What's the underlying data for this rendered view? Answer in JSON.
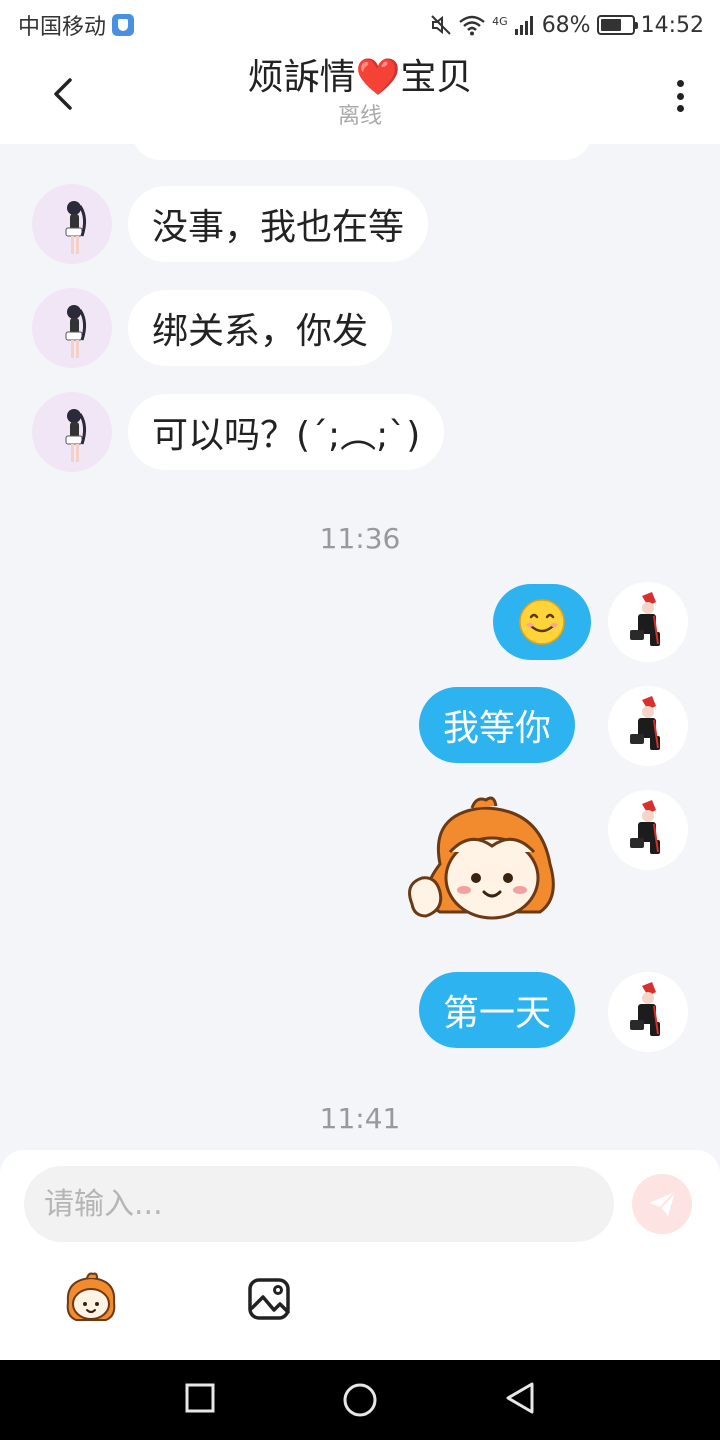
{
  "status_bar": {
    "carrier": "中国移动",
    "network": "4G",
    "battery": "68%",
    "battery_level": 0.68,
    "time": "14:52"
  },
  "header": {
    "title": "烦訴情❤️宝贝",
    "status": "离线"
  },
  "messages": {
    "incoming": [
      {
        "text": "没事，我也在等"
      },
      {
        "text": "绑关系，你发"
      },
      {
        "text": "可以吗？(´;︵;`)"
      }
    ],
    "time_1": "11:36",
    "outgoing": [
      {
        "text": "😊"
      },
      {
        "text": "我等你"
      },
      {
        "sticker": "orange-hair-girl-sticker"
      },
      {
        "text": "第一天"
      }
    ],
    "time_2": "11:41"
  },
  "input": {
    "placeholder": "请输入...",
    "value": ""
  },
  "colors": {
    "outgoing_bubble": "#2db3f0",
    "incoming_bubble": "#ffffff",
    "background": "#f4f5f9",
    "send_button": "#fde3e1"
  },
  "icons": {
    "back": "chevron-left-icon",
    "more": "more-vertical-icon",
    "send": "paper-plane-icon",
    "emoji": "sticker-face-icon",
    "image": "image-icon",
    "nav": [
      "square-icon",
      "circle-icon",
      "triangle-back-icon"
    ]
  }
}
